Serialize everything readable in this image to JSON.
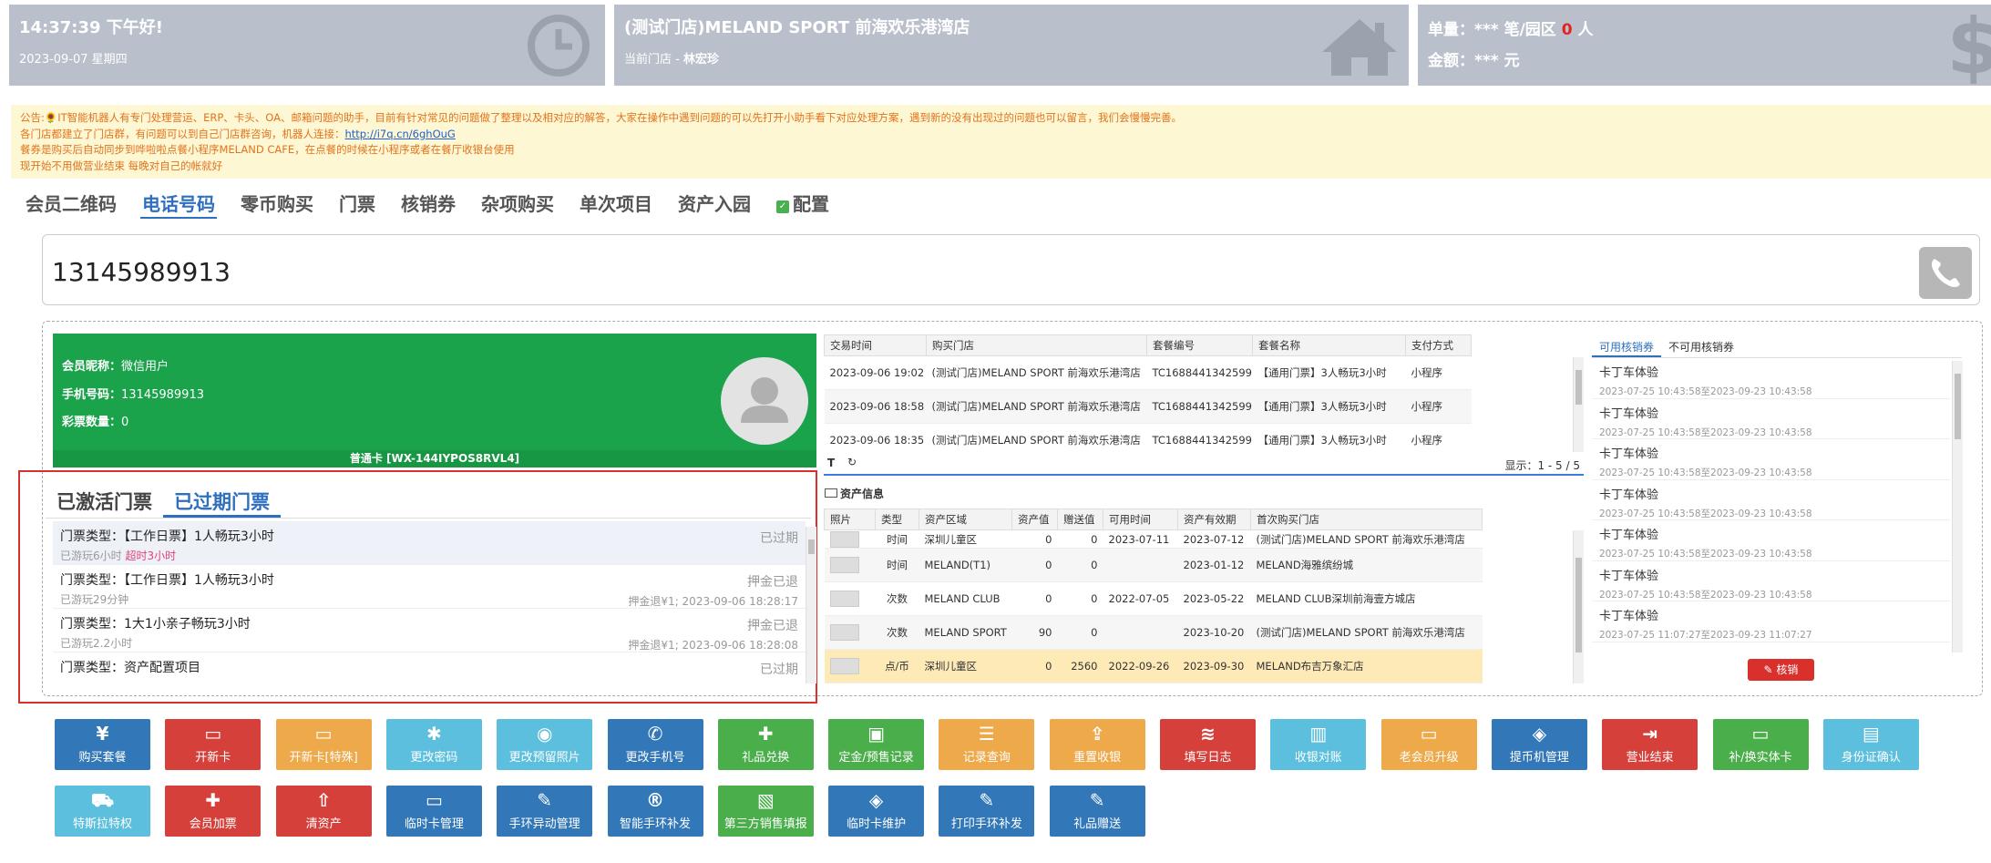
{
  "header": {
    "clock_card": {
      "time_greeting": "14:37:39 下午好!",
      "date": "2023-09-07 星期四"
    },
    "store_card": {
      "store_name": "(测试门店)MELAND SPORT 前海欢乐港湾店",
      "current_store_label": "当前门店 - ",
      "current_user": "林宏珍"
    },
    "stats_card": {
      "orders_label": "单量：*** 笔/园区 ",
      "orders_park_count": "0",
      "orders_unit": " 人",
      "amount_label": "金额：*** 元"
    }
  },
  "notice": {
    "line1": "公告:🌻IT智能机器人有专门处理营运、ERP、卡头、OA、邮箱问题的助手，目前有针对常见的问题做了整理以及相对应的解答，大家在操作中遇到问题的可以先打开小助手看下对应处理方案，遇到新的没有出现过的问题也可以留言，我们会慢慢完善。",
    "line2_prefix": "各门店都建立了门店群，有问题可以到自己门店群咨询，机器人连接：",
    "line2_link": "http://i7q.cn/6ghOuG",
    "line3": "餐券是购买后自动同步到哗啦啦点餐小程序MELAND CAFE，在点餐的时候在小程序或者在餐厅收银台使用",
    "line4": "现开始不用做营业结束 每晚对自己的帐就好"
  },
  "nav_tabs": [
    {
      "label": "会员二维码",
      "active": false
    },
    {
      "label": "电话号码",
      "active": true
    },
    {
      "label": "零币购买",
      "active": false
    },
    {
      "label": "门票",
      "active": false
    },
    {
      "label": "核销券",
      "active": false
    },
    {
      "label": "杂项购买",
      "active": false
    },
    {
      "label": "单次项目",
      "active": false
    },
    {
      "label": "资产入园",
      "active": false
    },
    {
      "label": "配置",
      "active": false
    }
  ],
  "phone_input": {
    "value": "13145989913"
  },
  "member": {
    "nickname_label": "会员昵称：",
    "nickname": "微信用户",
    "phone_label": "手机号码：",
    "phone": "13145989913",
    "lottery_label": "彩票数量：",
    "lottery": "0",
    "card_no": "普通卡 [WX-144IYPOS8RVL4]"
  },
  "ticket_tabs": [
    {
      "label": "已激活门票",
      "active": false
    },
    {
      "label": "已过期门票",
      "active": true
    }
  ],
  "tickets": [
    {
      "type": "门票类型：【工作日票】1人畅玩3小时",
      "played": "已游玩6小时 ",
      "overtime": "超时3小时",
      "status": "已过期",
      "detail": ""
    },
    {
      "type": "门票类型：【工作日票】1人畅玩3小时",
      "played": "已游玩29分钟",
      "overtime": "",
      "status": "押金已退",
      "detail": "押金退¥1; 2023-09-06 18:28:17"
    },
    {
      "type": "门票类型：1大1小亲子畅玩3小时",
      "played": "已游玩2.2小时",
      "overtime": "",
      "status": "押金已退",
      "detail": "押金退¥1; 2023-09-06 18:28:08"
    },
    {
      "type": "门票类型：资产配置项目",
      "played": "",
      "overtime": "",
      "status": "已过期",
      "detail": ""
    }
  ],
  "transactions": {
    "headers": [
      "交易时间",
      "购买门店",
      "套餐编号",
      "套餐名称",
      "支付方式"
    ],
    "rows": [
      [
        "2023-09-06 19:02",
        "(测试门店)MELAND SPORT 前海欢乐港湾店",
        "TC1688441342599",
        "【通用门票】3人畅玩3小时",
        "小程序"
      ],
      [
        "2023-09-06 18:58",
        "(测试门店)MELAND SPORT 前海欢乐港湾店",
        "TC1688441342599",
        "【通用门票】3人畅玩3小时",
        "小程序"
      ],
      [
        "2023-09-06 18:35",
        "(测试门店)MELAND SPORT 前海欢乐港湾店",
        "TC1688441342599",
        "【通用门票】3人畅玩3小时",
        "小程序"
      ]
    ],
    "pager": "显示：1 - 5 / 5"
  },
  "assets": {
    "title": "资产信息",
    "headers": [
      "照片",
      "类型",
      "资产区域",
      "资产值",
      "赠送值",
      "可用时间",
      "资产有效期",
      "首次购买门店"
    ],
    "rows": [
      [
        "",
        "时间",
        "深圳儿童区",
        "0",
        "0",
        "2023-07-11",
        "2023-07-12",
        "(测试门店)MELAND SPORT 前海欢乐港湾店"
      ],
      [
        "",
        "时间",
        "MELAND(T1)",
        "0",
        "0",
        "",
        "2023-01-12",
        "MELAND海雅缤纷城"
      ],
      [
        "",
        "次数",
        "MELAND CLUB",
        "0",
        "0",
        "2022-07-05",
        "2023-05-22",
        "MELAND CLUB深圳前海壹方城店"
      ],
      [
        "",
        "次数",
        "MELAND SPORT",
        "90",
        "0",
        "",
        "2023-10-20",
        "(测试门店)MELAND SPORT 前海欢乐港湾店"
      ],
      [
        "",
        "点/币",
        "深圳儿童区",
        "0",
        "2560",
        "2022-09-26",
        "2023-09-30",
        "MELAND布吉万象汇店"
      ]
    ]
  },
  "coupons": {
    "tabs": [
      {
        "label": "可用核销券",
        "active": true
      },
      {
        "label": "不可用核销券",
        "active": false
      }
    ],
    "items": [
      {
        "name": "卡丁车体验",
        "period": "2023-07-25 10:43:58至2023-09-23 10:43:58"
      },
      {
        "name": "卡丁车体验",
        "period": "2023-07-25 10:43:58至2023-09-23 10:43:58"
      },
      {
        "name": "卡丁车体验",
        "period": "2023-07-25 10:43:58至2023-09-23 10:43:58"
      },
      {
        "name": "卡丁车体验",
        "period": "2023-07-25 10:43:58至2023-09-23 10:43:58"
      },
      {
        "name": "卡丁车体验",
        "period": "2023-07-25 10:43:58至2023-09-23 10:43:58"
      },
      {
        "name": "卡丁车体验",
        "period": "2023-07-25 10:43:58至2023-09-23 10:43:58"
      },
      {
        "name": "卡丁车体验",
        "period": "2023-07-25 11:07:27至2023-09-23 11:07:27"
      }
    ],
    "writeoff_label": "核销"
  },
  "actions": [
    {
      "label": "购买套餐",
      "icon": "¥",
      "color": "blue"
    },
    {
      "label": "开新卡",
      "icon": "▭",
      "color": "red"
    },
    {
      "label": "开新卡[特殊]",
      "icon": "▭",
      "color": "orange"
    },
    {
      "label": "更改密码",
      "icon": "✱",
      "color": "cyan"
    },
    {
      "label": "更改预留照片",
      "icon": "◉",
      "color": "cyan"
    },
    {
      "label": "更改手机号",
      "icon": "✆",
      "color": "blue"
    },
    {
      "label": "礼品兑换",
      "icon": "✚",
      "color": "green"
    },
    {
      "label": "定金/预售记录",
      "icon": "▣",
      "color": "green"
    },
    {
      "label": "记录查询",
      "icon": "☰",
      "color": "orange"
    },
    {
      "label": "重置收银",
      "icon": "⇪",
      "color": "orange"
    },
    {
      "label": "填写日志",
      "icon": "≋",
      "color": "red"
    },
    {
      "label": "收银对账",
      "icon": "▥",
      "color": "cyan"
    },
    {
      "label": "老会员升级",
      "icon": "▭",
      "color": "orange"
    },
    {
      "label": "提币机管理",
      "icon": "◈",
      "color": "blue"
    },
    {
      "label": "营业结束",
      "icon": "⇥",
      "color": "red"
    },
    {
      "label": "补/换实体卡",
      "icon": "▭",
      "color": "green"
    },
    {
      "label": "身份证确认",
      "icon": "▤",
      "color": "cyan"
    },
    {
      "label": "特斯拉特权",
      "icon": "⛟",
      "color": "cyan"
    },
    {
      "label": "会员加票",
      "icon": "✚",
      "color": "red"
    },
    {
      "label": "清资产",
      "icon": "⇧",
      "color": "red"
    },
    {
      "label": "临时卡管理",
      "icon": "▭",
      "color": "blue"
    },
    {
      "label": "手环异动管理",
      "icon": "✎",
      "color": "blue"
    },
    {
      "label": "智能手环补发",
      "icon": "®",
      "color": "blue"
    },
    {
      "label": "第三方销售填报",
      "icon": "▧",
      "color": "green"
    },
    {
      "label": "临时卡维护",
      "icon": "◈",
      "color": "blue"
    },
    {
      "label": "打印手环补发",
      "icon": "✎",
      "color": "blue"
    },
    {
      "label": "礼品赠送",
      "icon": "✎",
      "color": "blue"
    }
  ]
}
